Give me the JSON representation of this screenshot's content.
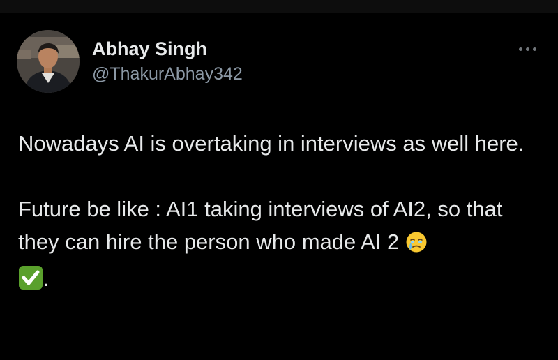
{
  "tweet": {
    "author": {
      "display_name": "Abhay Singh",
      "handle": "@ThakurAbhay342"
    },
    "paragraphs": [
      "Nowadays AI is overtaking in interviews as well here.",
      "Future be like : AI1 taking interviews of AI2, so that they can hire the person who made AI 2"
    ],
    "trailing_period": ".",
    "emojis": [
      "face-holding-back-tears-icon",
      "check-mark-button-icon"
    ]
  },
  "colors": {
    "background": "#000000",
    "primary_text": "#e7e9ea",
    "secondary_text": "#8b98a5",
    "check_green": "#5aa02c"
  }
}
